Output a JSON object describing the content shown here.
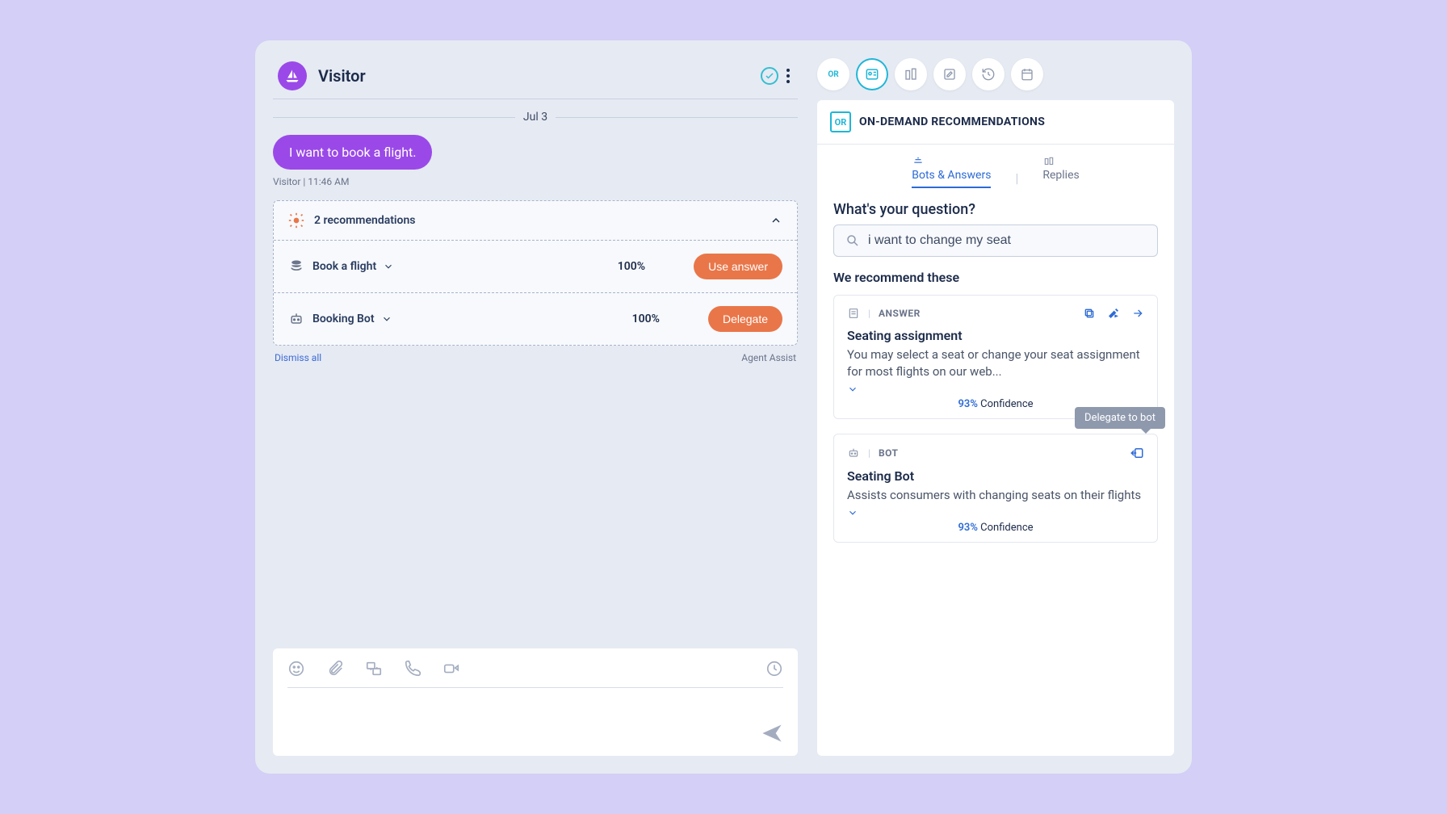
{
  "chat": {
    "title": "Visitor",
    "date": "Jul 3",
    "message": "I want to book a flight.",
    "meta": "Visitor  |  11:46 AM"
  },
  "recs": {
    "title": "2 recommendations",
    "rows": [
      {
        "name": "Book a flight",
        "score": "100%",
        "action": "Use answer"
      },
      {
        "name": "Booking Bot",
        "score": "100%",
        "action": "Delegate"
      }
    ],
    "dismiss": "Dismiss all",
    "agent_assist": "Agent Assist"
  },
  "sidebar": {
    "panel_title": "ON-DEMAND RECOMMENDATIONS",
    "tabs": {
      "bots": "Bots & Answers",
      "replies": "Replies"
    },
    "prompt": "What's your question?",
    "search_value": "i want to change my seat",
    "recommend_title": "We recommend these",
    "tooltip": "Delegate to bot",
    "cards": [
      {
        "type": "ANSWER",
        "title": "Seating assignment",
        "desc": "You may select a seat or change your seat assignment for most flights on our web...",
        "pct": "93%",
        "conf": "Confidence"
      },
      {
        "type": "BOT",
        "title": "Seating Bot",
        "desc": "Assists consumers with changing seats on their flights",
        "pct": "93%",
        "conf": "Confidence"
      }
    ]
  }
}
